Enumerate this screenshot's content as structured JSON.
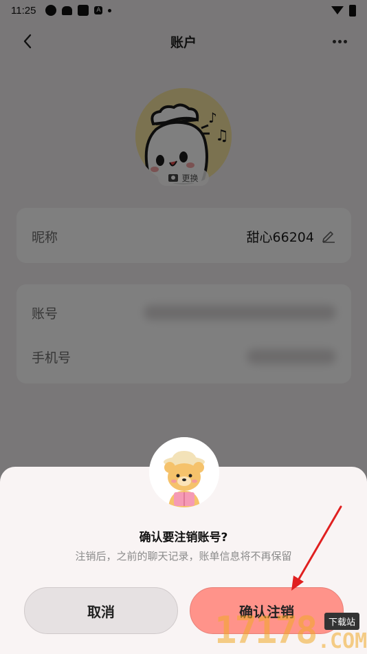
{
  "status_bar": {
    "time": "11:25",
    "icons": [
      "app-icon",
      "android-icon",
      "app-square-icon",
      "a-icon",
      "dot-icon"
    ],
    "a_icon_label": "A"
  },
  "header": {
    "title": "账户",
    "back_icon": "back-arrow-icon",
    "more_icon": "more-icon"
  },
  "profile": {
    "change_label": "更换"
  },
  "nickname_row": {
    "label": "昵称",
    "value": "甜心66204"
  },
  "account_rows": [
    {
      "label": "账号"
    },
    {
      "label": "手机号"
    }
  ],
  "dialog": {
    "title": "确认要注销账号?",
    "message": "注销后，之前的聊天记录，账单信息将不再保留",
    "cancel_label": "取消",
    "confirm_label": "确认注销"
  },
  "watermark": {
    "digits": "17178",
    "tag": "下载站",
    "com": ".COM"
  },
  "colors": {
    "confirm": "#ff938a",
    "cancel": "#e6e1e2",
    "sheet": "#f9f4f4",
    "arrow": "#e02020"
  }
}
